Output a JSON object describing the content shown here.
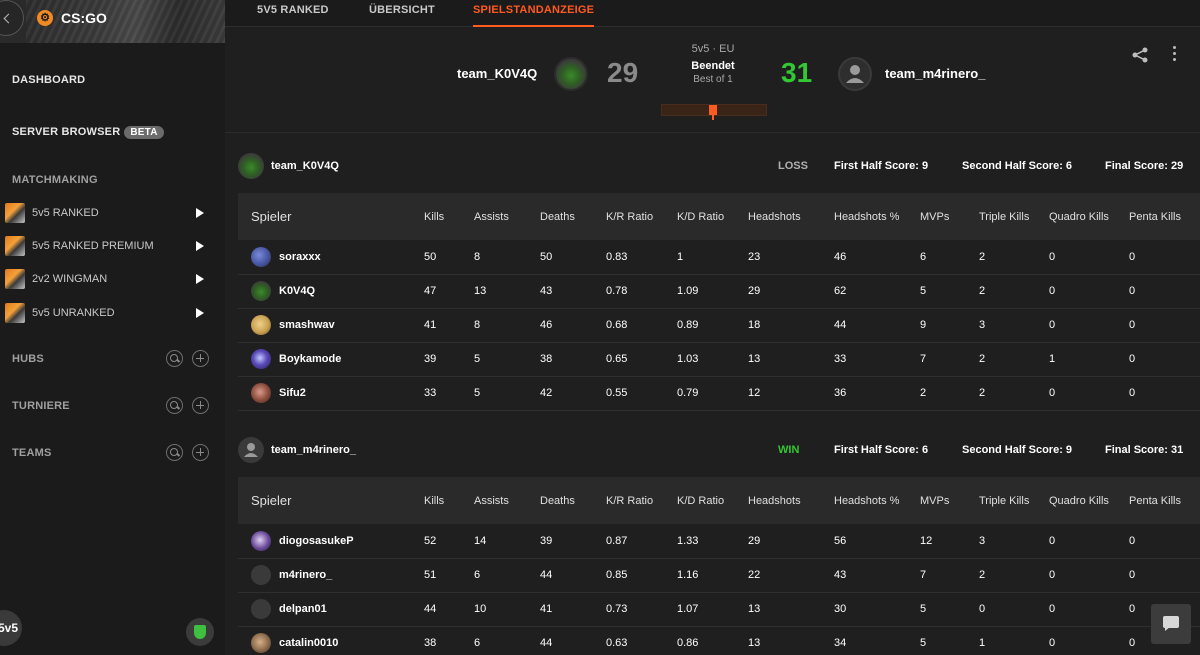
{
  "sidebar": {
    "game": {
      "label": "CS:GO",
      "icon": "csgo-logo-icon"
    },
    "dashboard": "DASHBOARD",
    "server_browser": "SERVER BROWSER",
    "beta": "BETA",
    "matchmaking": "MATCHMAKING",
    "mm_items": [
      "5v5 RANKED",
      "5v5 RANKED PREMIUM",
      "2v2 WINGMAN",
      "5v5 UNRANKED"
    ],
    "hubs": "HUBS",
    "turniere": "TURNIERE",
    "teams": "TEAMS",
    "bottom_badge": "5v5"
  },
  "tabs": [
    "5V5 RANKED",
    "ÜBERSICHT",
    "SPIELSTANDANZEIGE"
  ],
  "active_tab": "SPIELSTANDANZEIGE",
  "header": {
    "team1": "team_K0V4Q",
    "score1": "29",
    "mode": "5v5 · EU",
    "status": "Beendet",
    "best_of": "Best of 1",
    "score2": "31",
    "team2": "team_m4rinero_"
  },
  "columns": [
    "Spieler",
    "Kills",
    "Assists",
    "Deaths",
    "K/R Ratio",
    "K/D Ratio",
    "Headshots",
    "Headshots %",
    "MVPs",
    "Triple Kills",
    "Quadro Kills",
    "Penta Kills"
  ],
  "colors": {
    "accent": "#ff5a1f",
    "win": "#32c832",
    "loss": "#b0b0b0"
  },
  "teams": [
    {
      "name": "team_K0V4Q",
      "result": "LOSS",
      "first_half": "First Half Score: 9",
      "second_half": "Second Half Score: 6",
      "final": "Final Score: 29",
      "players": [
        [
          "soraxxx",
          "50",
          "8",
          "50",
          "0.83",
          "1",
          "23",
          "46",
          "6",
          "2",
          "0",
          "0"
        ],
        [
          "K0V4Q",
          "47",
          "13",
          "43",
          "0.78",
          "1.09",
          "29",
          "62",
          "5",
          "2",
          "0",
          "0"
        ],
        [
          "smashwav",
          "41",
          "8",
          "46",
          "0.68",
          "0.89",
          "18",
          "44",
          "9",
          "3",
          "0",
          "0"
        ],
        [
          "Boykamode",
          "39",
          "5",
          "38",
          "0.65",
          "1.03",
          "13",
          "33",
          "7",
          "2",
          "1",
          "0"
        ],
        [
          "Sifu2",
          "33",
          "5",
          "42",
          "0.55",
          "0.79",
          "12",
          "36",
          "2",
          "2",
          "0",
          "0"
        ]
      ]
    },
    {
      "name": "team_m4rinero_",
      "result": "WIN",
      "first_half": "First Half Score: 6",
      "second_half": "Second Half Score: 9",
      "final": "Final Score: 31",
      "players": [
        [
          "diogosasukeP",
          "52",
          "14",
          "39",
          "0.87",
          "1.33",
          "29",
          "56",
          "12",
          "3",
          "0",
          "0"
        ],
        [
          "m4rinero_",
          "51",
          "6",
          "44",
          "0.85",
          "1.16",
          "22",
          "43",
          "7",
          "2",
          "0",
          "0"
        ],
        [
          "delpan01",
          "44",
          "10",
          "41",
          "0.73",
          "1.07",
          "13",
          "30",
          "5",
          "0",
          "0",
          "0"
        ],
        [
          "catalin0010",
          "38",
          "6",
          "44",
          "0.63",
          "0.86",
          "13",
          "34",
          "5",
          "1",
          "0",
          "0"
        ]
      ]
    }
  ]
}
